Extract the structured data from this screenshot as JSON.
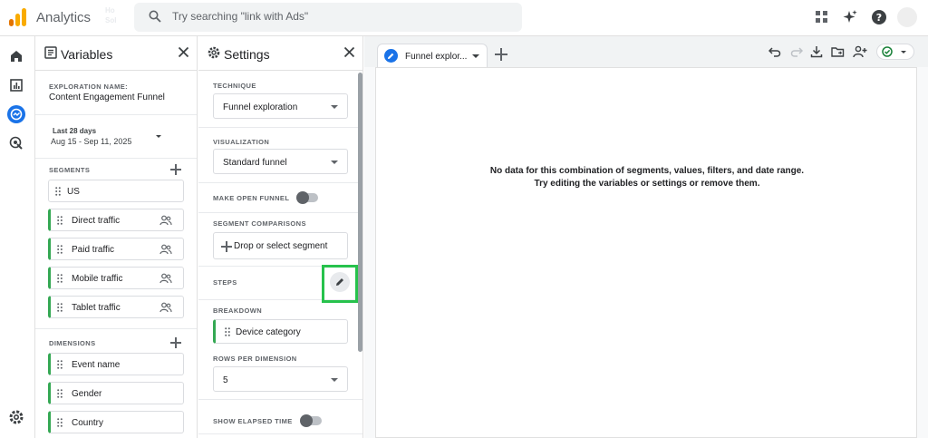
{
  "app": {
    "title": "Analytics",
    "ghost_text": "Ho\nSol",
    "search_placeholder": "Try searching \"link with Ads\""
  },
  "colors": {
    "logo_orange": "#f9ab00",
    "logo_dark_orange": "#e37400",
    "accent_blue": "#1a73e8",
    "segment_green": "#34a853",
    "highlight_green": "#27c24c",
    "status_green": "#188038"
  },
  "top_icons": [
    "apps-grid-icon",
    "sparkle-icon",
    "help-icon",
    "account-avatar"
  ],
  "rail_icons": [
    "home-icon",
    "reports-icon",
    "explore-icon",
    "advertising-icon",
    "admin-gear-icon"
  ],
  "variables": {
    "title": "Variables",
    "exploration_label": "EXPLORATION NAME:",
    "exploration_name": "Content Engagement Funnel",
    "date_label": "Last 28 days",
    "date_range": "Aug 15 - Sep 11, 2025",
    "segments_label": "SEGMENTS",
    "segments": [
      "US",
      "Direct traffic",
      "Paid traffic",
      "Mobile traffic",
      "Tablet traffic"
    ],
    "dimensions_label": "DIMENSIONS",
    "dimensions": [
      "Event name",
      "Gender",
      "Country"
    ]
  },
  "settings": {
    "title": "Settings",
    "technique_label": "TECHNIQUE",
    "technique_value": "Funnel exploration",
    "visualization_label": "VISUALIZATION",
    "visualization_value": "Standard funnel",
    "open_funnel_label": "MAKE OPEN FUNNEL",
    "segment_comparisons_label": "SEGMENT COMPARISONS",
    "segment_drop_text": "Drop or select segment",
    "steps_label": "STEPS",
    "breakdown_label": "BREAKDOWN",
    "breakdown_value": "Device category",
    "rows_label": "ROWS PER DIMENSION",
    "rows_value": "5",
    "elapsed_label": "SHOW ELAPSED TIME"
  },
  "canvas": {
    "tab_label": "Funnel explor...",
    "empty_line1": "No data for this combination of segments, values, filters, and date range.",
    "empty_line2": "Try editing the variables or settings or remove them.",
    "toolbar_icons": [
      "undo-icon",
      "redo-icon",
      "download-icon",
      "move-folder-icon",
      "share-user-icon",
      "status-check-icon"
    ]
  }
}
